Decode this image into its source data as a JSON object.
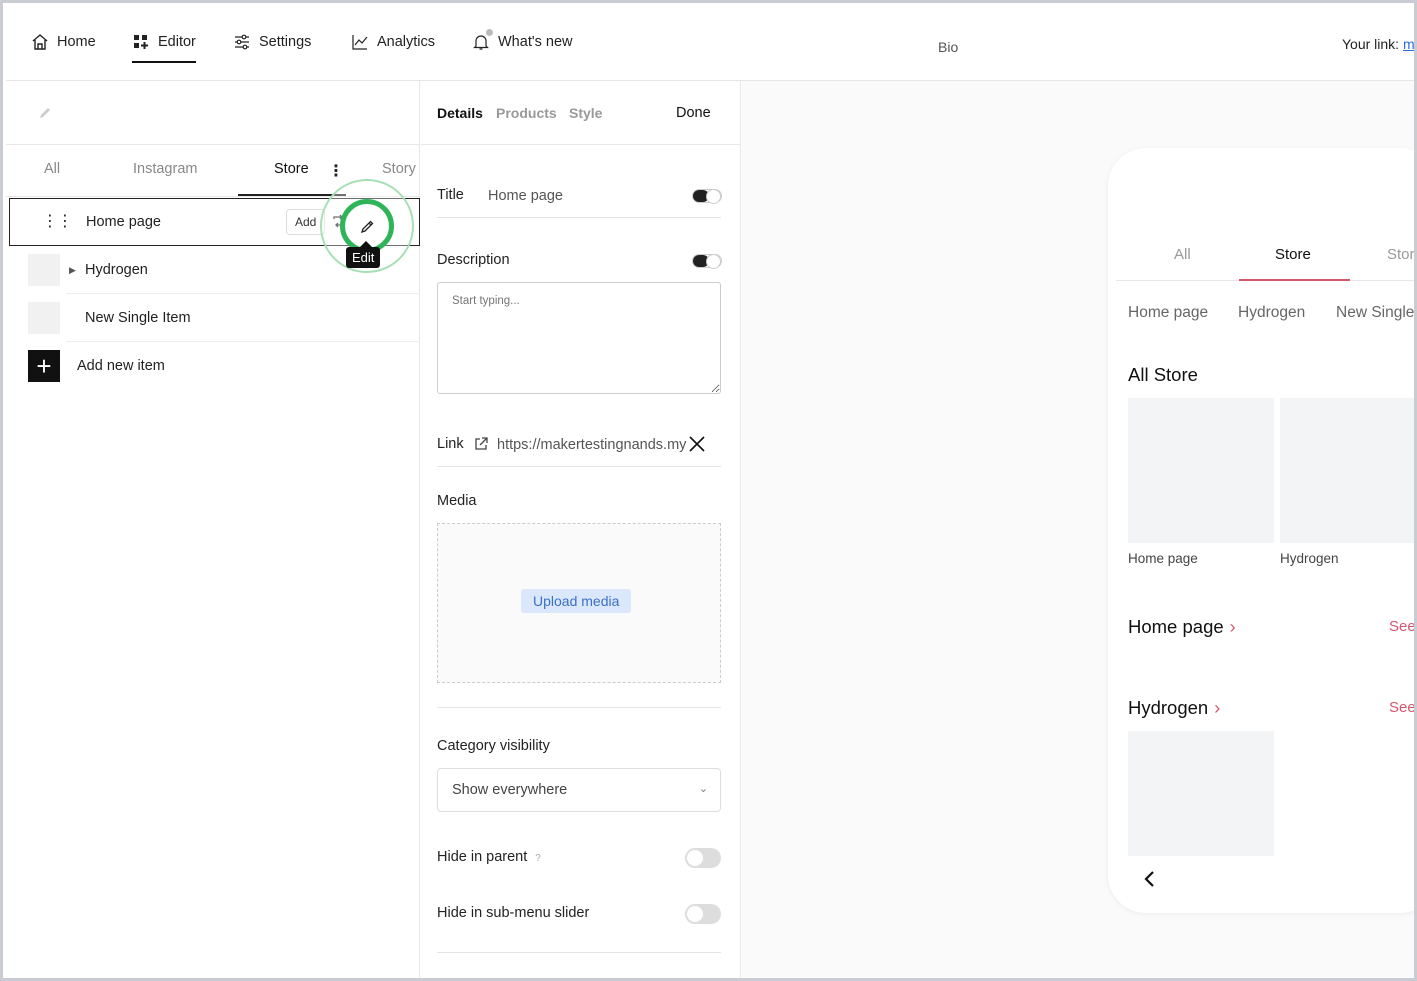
{
  "nav": {
    "home": "Home",
    "editor": "Editor",
    "settings": "Settings",
    "analytics": "Analytics",
    "whats_new": "What's new",
    "bio": "Bio",
    "your_link_label": "Your link:",
    "your_link_value": "m"
  },
  "left_panel": {
    "tabs": [
      "All",
      "Instagram",
      "Store",
      "Story"
    ],
    "active_tab": "Store",
    "items": [
      {
        "label": "Home page",
        "add_label": "Add"
      },
      {
        "label": "Hydrogen"
      },
      {
        "label": "New Single Item"
      }
    ],
    "add_new": "Add new item",
    "tooltip": "Edit"
  },
  "details_panel": {
    "tabs": [
      "Details",
      "Products",
      "Style"
    ],
    "done": "Done",
    "title_label": "Title",
    "title_value": "Home page",
    "description_label": "Description",
    "description_placeholder": "Start typing...",
    "link_label": "Link",
    "link_value": "https://makertestingnands.my",
    "media_label": "Media",
    "upload_label": "Upload media",
    "category_visibility_label": "Category visibility",
    "category_visibility_value": "Show everywhere",
    "hide_parent_label": "Hide in parent",
    "hide_parent_help": "?",
    "hide_slider_label": "Hide in sub-menu slider"
  },
  "preview": {
    "tabs": [
      "All",
      "Store",
      "Stor"
    ],
    "chips": [
      "Home page",
      "Hydrogen",
      "New Single"
    ],
    "all_store_heading": "All Store",
    "tiles": [
      "Home page",
      "Hydrogen"
    ],
    "section1": "Home page",
    "section2": "Hydrogen",
    "see": "See"
  },
  "colors": {
    "accent": "#d4576d",
    "edit_ring": "#2fb559",
    "upload_bg": "#dbe8fb"
  }
}
